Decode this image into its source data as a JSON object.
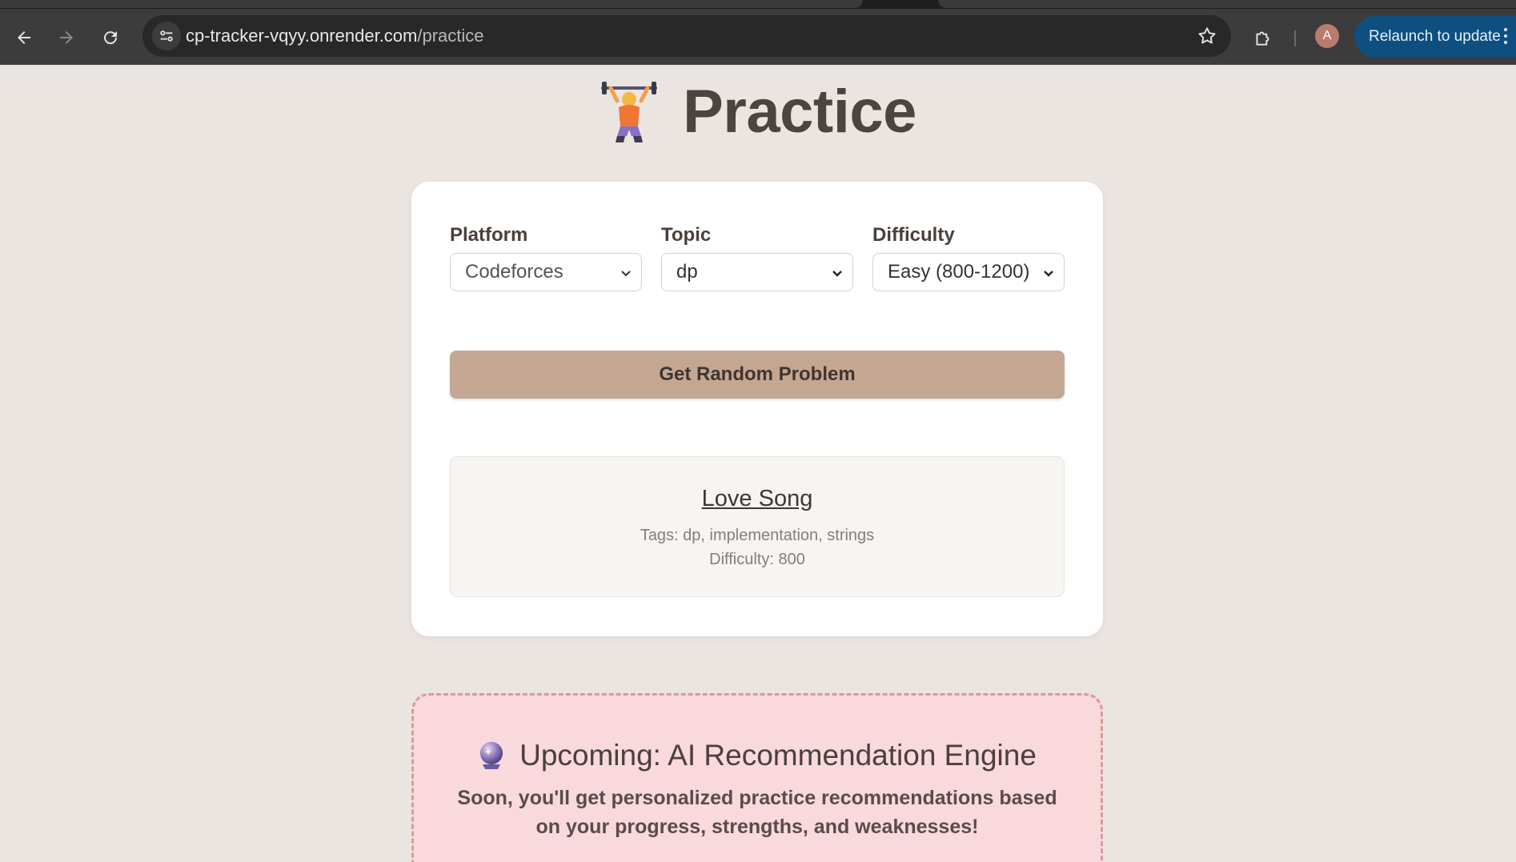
{
  "browser": {
    "url_host": "cp-tracker-vqyy.onrender.com",
    "url_path": "/practice",
    "avatar_letter": "A",
    "relaunch_label": "Relaunch to update"
  },
  "page": {
    "title": "Practice",
    "title_emoji": "weightlifter-icon"
  },
  "filters": {
    "platform": {
      "label": "Platform",
      "value": "Codeforces"
    },
    "topic": {
      "label": "Topic",
      "value": "dp"
    },
    "difficulty": {
      "label": "Difficulty",
      "value": "Easy (800-1200)"
    }
  },
  "random_button_label": "Get Random Problem",
  "problem": {
    "title": "Love Song",
    "tags": "Tags: dp, implementation, strings",
    "difficulty": "Difficulty: 800"
  },
  "upcoming": {
    "emoji": "crystal-ball-icon",
    "title": "Upcoming: AI Recommendation Engine",
    "description": "Soon, you'll get personalized practice recommendations based on your progress, strengths, and weaknesses!"
  },
  "colors": {
    "page_bg": "#ebe5e1",
    "button_bg": "#c4a793",
    "upcoming_bg": "#f9d9dc",
    "relaunch_bg": "#0e4f80"
  }
}
